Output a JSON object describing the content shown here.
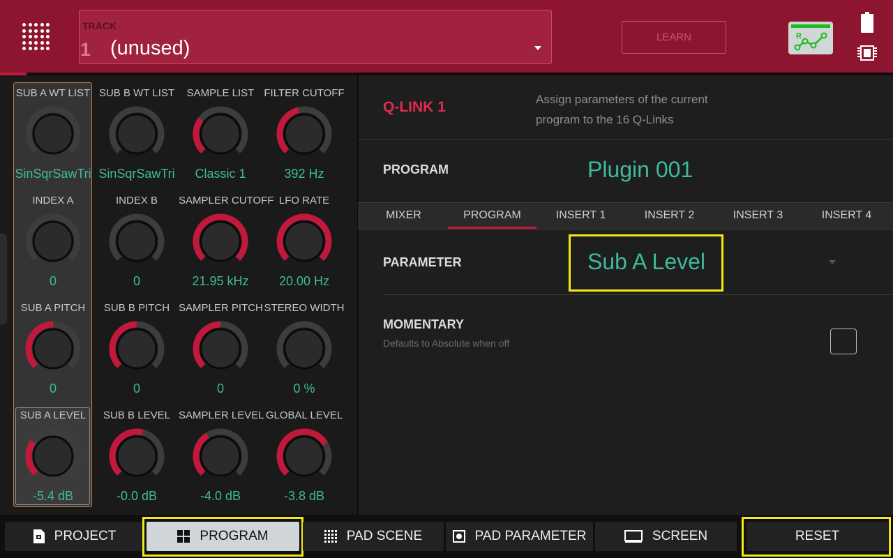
{
  "header": {
    "track_caption": "TRACK",
    "track_number": "1",
    "track_name": "(unused)",
    "learn_label": "LEARN",
    "automation_letter": "R"
  },
  "knobs": [
    {
      "label": "SUB A WT LIST",
      "value": "SinSqrSawTri",
      "level": 0.0
    },
    {
      "label": "SUB B WT LIST",
      "value": "SinSqrSawTri",
      "level": 0.0
    },
    {
      "label": "SAMPLE LIST",
      "value": "Classic 1",
      "level": 0.3
    },
    {
      "label": "FILTER CUTOFF",
      "value": "392 Hz",
      "level": 0.45
    },
    {
      "label": "INDEX A",
      "value": "0",
      "level": 0.0
    },
    {
      "label": "INDEX B",
      "value": "0",
      "level": 0.0
    },
    {
      "label": "SAMPLER CUTOFF",
      "value": "21.95 kHz",
      "level": 1.0
    },
    {
      "label": "LFO RATE",
      "value": "20.00 Hz",
      "level": 1.0
    },
    {
      "label": "SUB A PITCH",
      "value": "0",
      "level": 0.5
    },
    {
      "label": "SUB B PITCH",
      "value": "0",
      "level": 0.5
    },
    {
      "label": "SAMPLER PITCH",
      "value": "0",
      "level": 0.5
    },
    {
      "label": "STEREO WIDTH",
      "value": "0 %",
      "level": 0.0
    },
    {
      "label": "SUB A LEVEL",
      "value": "-5.4 dB",
      "level": 0.3
    },
    {
      "label": "SUB B LEVEL",
      "value": "-0.0 dB",
      "level": 0.55
    },
    {
      "label": "SAMPLER LEVEL",
      "value": "-4.0 dB",
      "level": 0.38
    },
    {
      "label": "GLOBAL LEVEL",
      "value": "-3.8 dB",
      "level": 0.72
    }
  ],
  "qlink": {
    "title": "Q-LINK 1",
    "description": "Assign parameters of the current program to the 16 Q-Links"
  },
  "program": {
    "label": "PROGRAM",
    "value": "Plugin 001"
  },
  "tabs": [
    {
      "label": "MIXER"
    },
    {
      "label": "PROGRAM"
    },
    {
      "label": "INSERT 1"
    },
    {
      "label": "INSERT 2"
    },
    {
      "label": "INSERT 3"
    },
    {
      "label": "INSERT 4"
    }
  ],
  "active_tab": "PROGRAM",
  "parameter": {
    "label": "PARAMETER",
    "value": "Sub A Level"
  },
  "momentary": {
    "label": "MOMENTARY",
    "sublabel": "Defaults to Absolute when off",
    "checked": false
  },
  "bottom_bar": {
    "project": "PROJECT",
    "program": "PROGRAM",
    "pad_scene": "PAD SCENE",
    "pad_parameter": "PAD PARAMETER",
    "screen": "SCREEN",
    "reset": "RESET"
  },
  "colors": {
    "header": "#8e1530",
    "accent": "#c2183c",
    "value_text": "#3dbb99",
    "highlight": "#f2ea18",
    "knob_arc": "#c2183c"
  }
}
